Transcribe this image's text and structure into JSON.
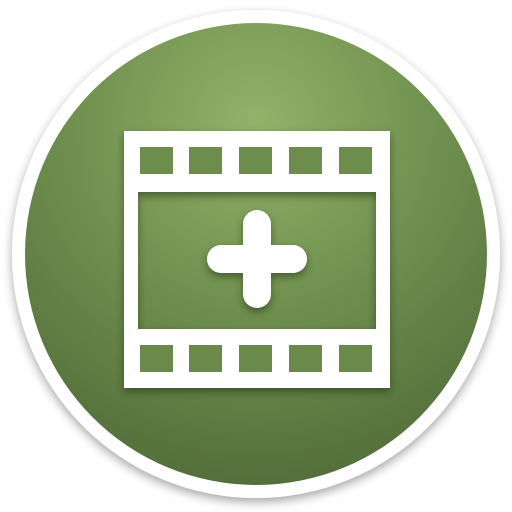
{
  "icon": {
    "name": "add-video-icon",
    "glyph": "film-strip-with-plus",
    "colors": {
      "badge_light": "#93b26a",
      "badge_mid": "#6d8d4d",
      "badge_dark": "#546f3b",
      "ring": "#ffffff",
      "glyph": "#ffffff"
    }
  }
}
